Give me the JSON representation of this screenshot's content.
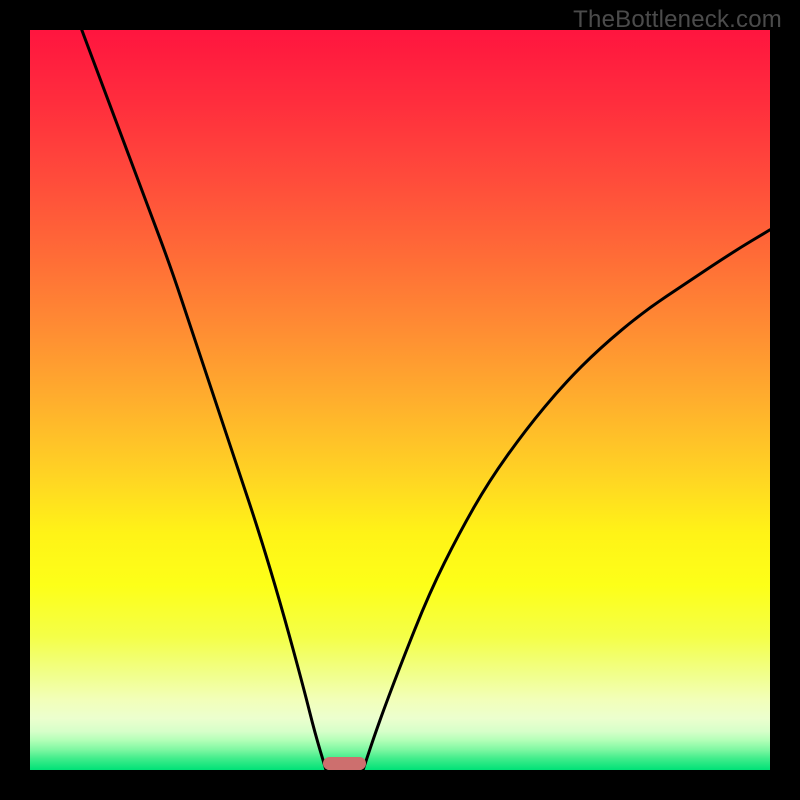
{
  "watermark": "TheBottleneck.com",
  "chart_data": {
    "type": "line",
    "title": "",
    "xlabel": "",
    "ylabel": "",
    "xlim": [
      0,
      100
    ],
    "ylim": [
      0,
      100
    ],
    "legend": false,
    "grid": false,
    "series": [
      {
        "name": "left-branch",
        "x": [
          7,
          10,
          13,
          16,
          19,
          22,
          25,
          28,
          31,
          34,
          37,
          38.5,
          40
        ],
        "y": [
          100,
          92,
          84,
          76,
          68,
          59,
          50,
          41,
          32,
          22,
          11,
          5,
          0
        ]
      },
      {
        "name": "right-branch",
        "x": [
          45,
          47,
          50,
          54,
          58,
          62,
          67,
          72,
          77,
          83,
          89,
          95,
          100
        ],
        "y": [
          0,
          6,
          14,
          24,
          32,
          39,
          46,
          52,
          57,
          62,
          66,
          70,
          73
        ]
      }
    ],
    "marker": {
      "name": "bottleneck-marker",
      "x_center": 42.5,
      "width_pct": 5.8,
      "height_pct": 1.8,
      "color": "#cd6f6e"
    },
    "background_gradient": {
      "stops": [
        {
          "pos": 0.0,
          "color": "#ff153f"
        },
        {
          "pos": 0.1,
          "color": "#ff2e3d"
        },
        {
          "pos": 0.2,
          "color": "#ff4b3b"
        },
        {
          "pos": 0.3,
          "color": "#ff6a37"
        },
        {
          "pos": 0.4,
          "color": "#ff8b33"
        },
        {
          "pos": 0.5,
          "color": "#ffae2d"
        },
        {
          "pos": 0.6,
          "color": "#ffd324"
        },
        {
          "pos": 0.68,
          "color": "#fff317"
        },
        {
          "pos": 0.75,
          "color": "#fdff18"
        },
        {
          "pos": 0.82,
          "color": "#f4ff48"
        },
        {
          "pos": 0.87,
          "color": "#f1ff8a"
        },
        {
          "pos": 0.905,
          "color": "#f2ffb9"
        },
        {
          "pos": 0.93,
          "color": "#ecffce"
        },
        {
          "pos": 0.948,
          "color": "#d6ffc9"
        },
        {
          "pos": 0.96,
          "color": "#b2ffb7"
        },
        {
          "pos": 0.972,
          "color": "#81f8a3"
        },
        {
          "pos": 0.984,
          "color": "#43ed8c"
        },
        {
          "pos": 1.0,
          "color": "#00e277"
        }
      ]
    }
  }
}
